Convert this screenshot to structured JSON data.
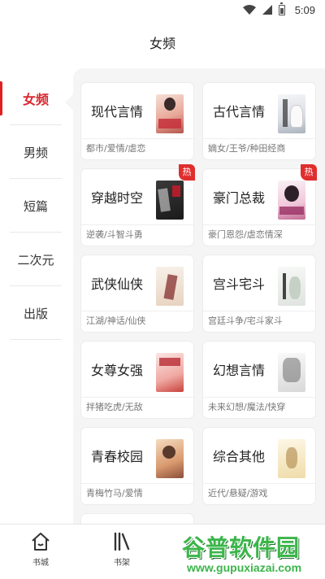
{
  "status_bar": {
    "time": "5:09"
  },
  "header": {
    "title": "女频"
  },
  "sidebar": {
    "items": [
      {
        "label": "女频",
        "active": true
      },
      {
        "label": "男频",
        "active": false
      },
      {
        "label": "短篇",
        "active": false
      },
      {
        "label": "二次元",
        "active": false
      },
      {
        "label": "出版",
        "active": false
      }
    ]
  },
  "categories": [
    {
      "title": "现代言情",
      "tags": "都市/爱情/虐恋",
      "hot": false,
      "cover_color": "#e9b9a8",
      "cover_text": "我不是你的小神秘"
    },
    {
      "title": "古代言情",
      "tags": "嫡女/王爷/种田经商",
      "hot": false,
      "cover_color": "#e8ecef",
      "cover_text": "王子爷"
    },
    {
      "title": "穿越时空",
      "tags": "逆袭/斗智斗勇",
      "hot": true,
      "hot_label": "热",
      "cover_color": "#2a2a2a",
      "cover_text": ""
    },
    {
      "title": "豪门总裁",
      "tags": "豪门恩怨/虐恋情深",
      "hot": true,
      "hot_label": "热",
      "cover_color": "#f2d7e3",
      "cover_text": "先婚后爱"
    },
    {
      "title": "武侠仙侠",
      "tags": "江湖/神话/仙侠",
      "hot": false,
      "cover_color": "#efe3d6",
      "cover_text": ""
    },
    {
      "title": "宫斗宅斗",
      "tags": "宫廷斗争/宅斗家斗",
      "hot": false,
      "cover_color": "#eef1ee",
      "cover_text": ""
    },
    {
      "title": "女尊女强",
      "tags": "拌猪吃虎/无敌",
      "hot": false,
      "cover_color": "#f5d2cf",
      "cover_text": ""
    },
    {
      "title": "幻想言情",
      "tags": "未来幻想/魔法/快穿",
      "hot": false,
      "cover_color": "#f0f0f0",
      "cover_text": ""
    },
    {
      "title": "青春校园",
      "tags": "青梅竹马/爱情",
      "hot": false,
      "cover_color": "#e9c9a5",
      "cover_text": ""
    },
    {
      "title": "综合其他",
      "tags": "近代/悬疑/游戏",
      "hot": false,
      "cover_color": "#f4e9c9",
      "cover_text": ""
    }
  ],
  "bottom_nav": {
    "items": [
      {
        "label": "书城",
        "icon": "home-icon"
      },
      {
        "label": "书架",
        "icon": "bookshelf-icon"
      }
    ]
  },
  "watermark": {
    "brand": "谷普软件园",
    "url": "www.gupuxiazai.com"
  },
  "colors": {
    "accent": "#e02020",
    "panel_bg": "#f5f5f5"
  }
}
